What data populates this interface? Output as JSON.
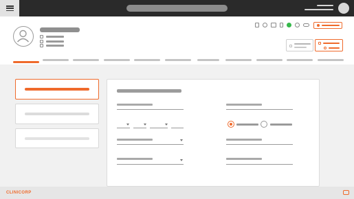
{
  "app": {
    "brand": "CLINICORP",
    "accent_color": "#ef6a2b",
    "topbar_color": "#2a2a2a"
  },
  "topbar": {
    "menu_icon": "hamburger-icon",
    "search_state": "placeholder-bar",
    "user_avatar_icon": "user-avatar-icon"
  },
  "patient": {
    "avatar_icon": "user-circle-icon",
    "info_icons": [
      "phone-icon",
      "mobile-icon",
      "mail-icon"
    ]
  },
  "header_actions": {
    "icons": [
      "clipboard-icon",
      "no-sign-icon",
      "printer-icon",
      "mobile-icon",
      "whatsapp-icon",
      "settings-icon",
      "link-icon"
    ],
    "status_color": "#35b84a"
  },
  "tabs": {
    "count": 11,
    "active_index": 0
  },
  "steps": {
    "count": 3,
    "active_index": 0
  },
  "form": {
    "radio_options": 2,
    "radio_selected_index": 0,
    "date_parts": 4
  }
}
